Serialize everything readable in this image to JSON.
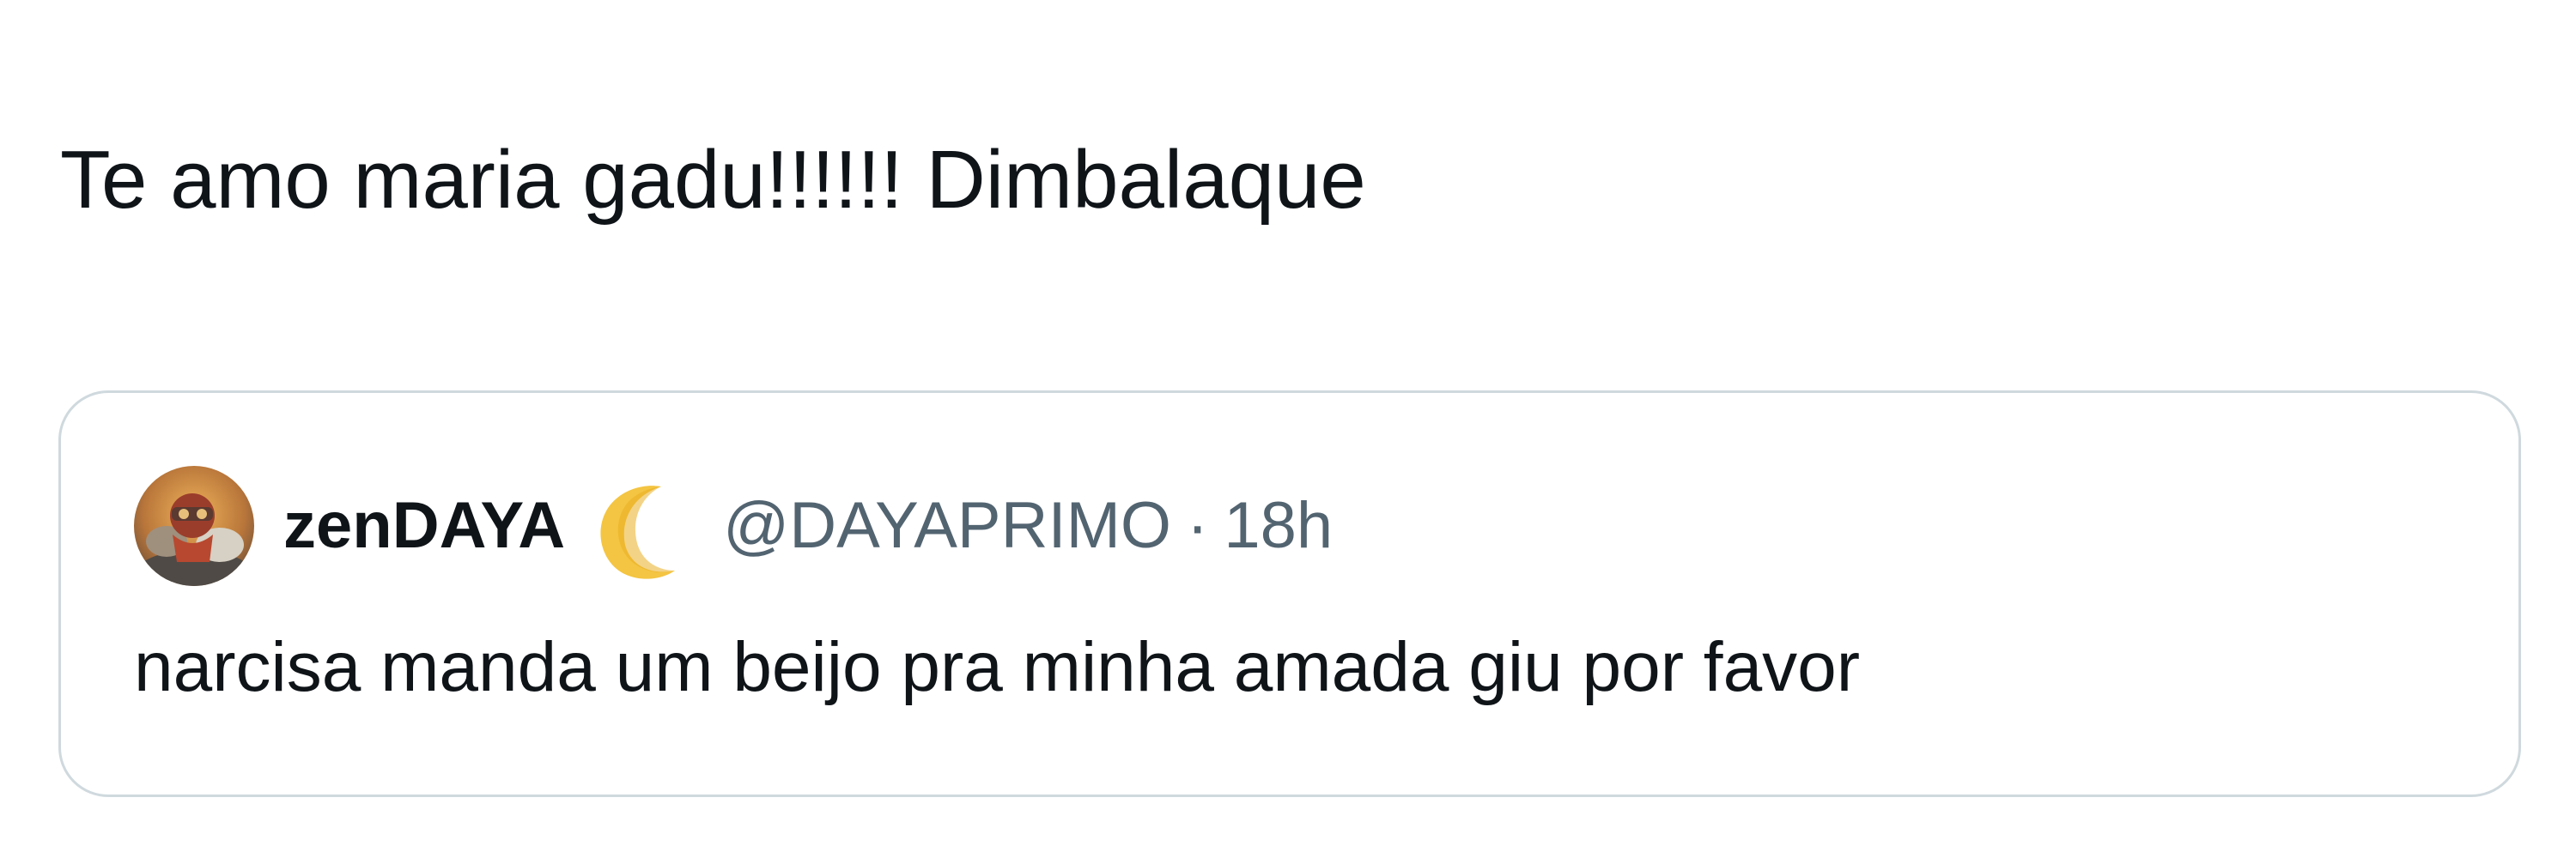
{
  "tweet": {
    "text": "Te amo maria gadu!!!!!! Dimbalaque"
  },
  "quoted_tweet": {
    "author": {
      "display_name": "zenDAYA",
      "name_emoji_icon": "crescent-moon-icon",
      "handle": "@DAYAPRIMO",
      "avatar_icon": "avatar-image"
    },
    "separator": "·",
    "time": "18h",
    "text": "narcisa manda um beijo pra minha amada giu por favor"
  },
  "colors": {
    "text_primary": "#0f1419",
    "text_secondary": "#536471",
    "border": "#cfd9de",
    "moon": "#f4c542"
  }
}
